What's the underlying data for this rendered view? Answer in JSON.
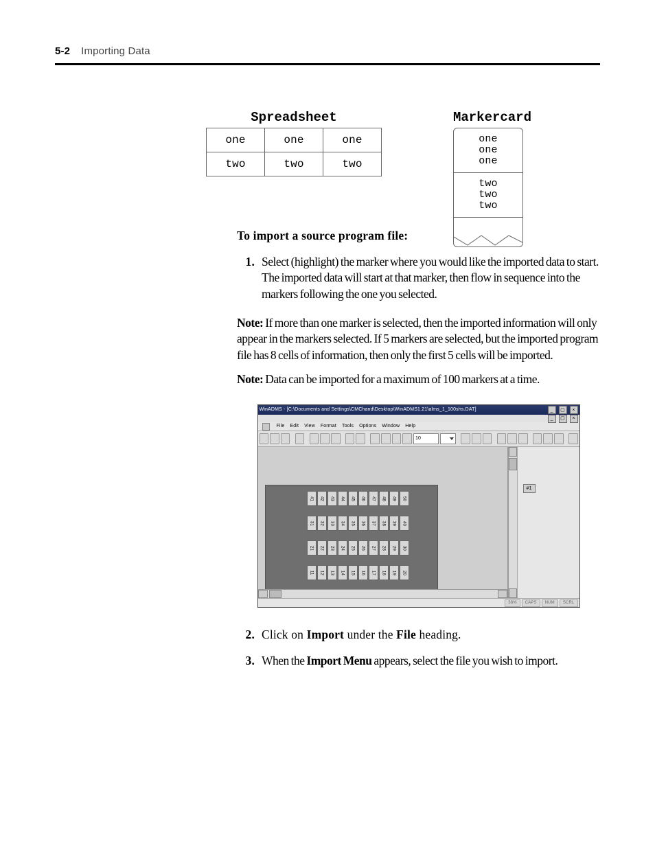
{
  "header": {
    "page_number": "5-2",
    "chapter": "Importing Data"
  },
  "figure": {
    "spreadsheet_title": "Spreadsheet",
    "markercard_title": "Markercard",
    "spreadsheet": [
      [
        "one",
        "one",
        "one"
      ],
      [
        "two",
        "two",
        "two"
      ]
    ],
    "markercard": [
      [
        "one",
        "one",
        "one"
      ],
      [
        "two",
        "two",
        "two"
      ]
    ]
  },
  "body": {
    "heading": "To import a source program file:",
    "step1_num": "1.",
    "step1": "Select (highlight) the marker where you would like the imported data to start. The imported data will start at that marker, then flow in sequence into the markers following the one you selected.",
    "note1_label": "Note:",
    "note1": " If more than one marker is selected, then the imported information will only appear in the markers selected. If 5 markers are selected, but the imported program file has 8 cells of information, then only the first 5 cells will be imported.",
    "note2_label": "Note:",
    "note2": " Data can be imported for a maximum of 100 markers at a time.",
    "step2_num": "2.",
    "step2_pre": "Click on ",
    "step2_b1": "Import",
    "step2_mid": " under the ",
    "step2_b2": "File",
    "step2_post": " heading.",
    "step3_num": "3.",
    "step3_pre": "When the ",
    "step3_b": "Import Menu",
    "step3_post": " appears, select the file you wish to import."
  },
  "shot": {
    "title": "WinADMS - [C:\\Documents and Settings\\CMChand\\Desktop\\WinADMS1.21\\alms_1_100shs.DAT]",
    "menus": [
      "File",
      "Edit",
      "View",
      "Format",
      "Tools",
      "Options",
      "Window",
      "Help"
    ],
    "combo_value": "10",
    "right_label": "#1",
    "status": [
      "38%",
      "CAPS",
      "NUM",
      "SCRL"
    ],
    "marker_rows": [
      [
        "41",
        "42",
        "43",
        "44",
        "45",
        "46",
        "47",
        "48",
        "49",
        "50"
      ],
      [
        "31",
        "32",
        "33",
        "34",
        "35",
        "36",
        "37",
        "38",
        "39",
        "40"
      ],
      [
        "21",
        "22",
        "23",
        "24",
        "25",
        "26",
        "27",
        "28",
        "29",
        "30"
      ],
      [
        "11",
        "12",
        "13",
        "14",
        "15",
        "16",
        "17",
        "18",
        "19",
        "20"
      ]
    ]
  }
}
